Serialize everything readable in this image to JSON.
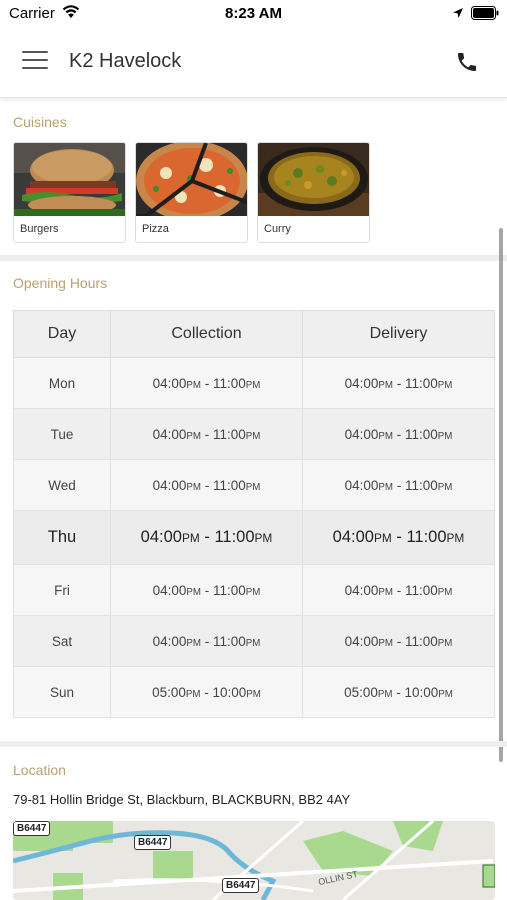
{
  "status_bar": {
    "carrier": "Carrier",
    "time": "8:23 AM"
  },
  "header": {
    "title": "K2 Havelock"
  },
  "cuisines": {
    "label": "Cuisines",
    "items": [
      {
        "label": "Burgers",
        "image": "burger-photo"
      },
      {
        "label": "Pizza",
        "image": "pizza-photo"
      },
      {
        "label": "Curry",
        "image": "curry-photo"
      }
    ]
  },
  "opening_hours": {
    "label": "Opening Hours",
    "headers": {
      "day": "Day",
      "collection": "Collection",
      "delivery": "Delivery"
    },
    "rows": [
      {
        "day": "Mon",
        "collection": {
          "open": "04:00",
          "open_ampm": "PM",
          "sep": " - ",
          "close": "11:00",
          "close_ampm": "PM"
        },
        "delivery": {
          "open": "04:00",
          "open_ampm": "PM",
          "sep": " - ",
          "close": "11:00",
          "close_ampm": "PM"
        }
      },
      {
        "day": "Tue",
        "collection": {
          "open": "04:00",
          "open_ampm": "PM",
          "sep": " - ",
          "close": "11:00",
          "close_ampm": "PM"
        },
        "delivery": {
          "open": "04:00",
          "open_ampm": "PM",
          "sep": " - ",
          "close": "11:00",
          "close_ampm": "PM"
        }
      },
      {
        "day": "Wed",
        "collection": {
          "open": "04:00",
          "open_ampm": "PM",
          "sep": " - ",
          "close": "11:00",
          "close_ampm": "PM"
        },
        "delivery": {
          "open": "04:00",
          "open_ampm": "PM",
          "sep": " - ",
          "close": "11:00",
          "close_ampm": "PM"
        }
      },
      {
        "day": "Thu",
        "collection": {
          "open": "04:00",
          "open_ampm": "PM",
          "sep": " - ",
          "close": "11:00",
          "close_ampm": "PM"
        },
        "delivery": {
          "open": "04:00",
          "open_ampm": "PM",
          "sep": " - ",
          "close": "11:00",
          "close_ampm": "PM"
        }
      },
      {
        "day": "Fri",
        "collection": {
          "open": "04:00",
          "open_ampm": "PM",
          "sep": " - ",
          "close": "11:00",
          "close_ampm": "PM"
        },
        "delivery": {
          "open": "04:00",
          "open_ampm": "PM",
          "sep": " - ",
          "close": "11:00",
          "close_ampm": "PM"
        }
      },
      {
        "day": "Sat",
        "collection": {
          "open": "04:00",
          "open_ampm": "PM",
          "sep": " - ",
          "close": "11:00",
          "close_ampm": "PM"
        },
        "delivery": {
          "open": "04:00",
          "open_ampm": "PM",
          "sep": " - ",
          "close": "11:00",
          "close_ampm": "PM"
        }
      },
      {
        "day": "Sun",
        "collection": {
          "open": "05:00",
          "open_ampm": "PM",
          "sep": " - ",
          "close": "10:00",
          "close_ampm": "PM"
        },
        "delivery": {
          "open": "05:00",
          "open_ampm": "PM",
          "sep": " - ",
          "close": "10:00",
          "close_ampm": "PM"
        }
      }
    ],
    "highlighted_day": "Thu"
  },
  "location": {
    "label": "Location",
    "address": "79-81 Hollin Bridge St, Blackburn, BLACKBURN, BB2 4AY",
    "map": {
      "road_labels": [
        "B6447",
        "B6447",
        "B6447"
      ],
      "street_label": "OLLIN ST"
    }
  },
  "colors": {
    "section_label": "#b8a16f",
    "table_header": "#efefef",
    "map_water": "#6fb7d6",
    "map_park": "#a8d98e"
  }
}
